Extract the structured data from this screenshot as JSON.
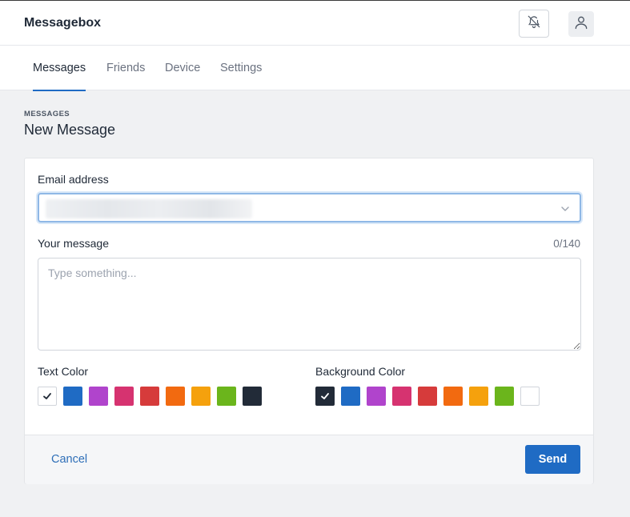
{
  "app": {
    "title": "Messagebox"
  },
  "header": {
    "bell_icon": "bell-off-icon",
    "user_icon": "user-icon"
  },
  "tabs": [
    {
      "label": "Messages",
      "active": true
    },
    {
      "label": "Friends",
      "active": false
    },
    {
      "label": "Device",
      "active": false
    },
    {
      "label": "Settings",
      "active": false
    }
  ],
  "page": {
    "eyebrow": "MESSAGES",
    "title": "New Message"
  },
  "form": {
    "email_label": "Email address",
    "email_value": "••••••• ••••••••••••.•••",
    "message_label": "Your message",
    "message_counter": "0/140",
    "message_placeholder": "Type something...",
    "text_color_label": "Text Color",
    "background_color_label": "Background Color",
    "text_colors": [
      "#ffffff",
      "#1f6bc4",
      "#b044cc",
      "#d63370",
      "#d63b3b",
      "#f26a10",
      "#f5a10d",
      "#6bb51c",
      "#222b38"
    ],
    "text_color_selected": "#ffffff",
    "background_colors": [
      "#222b38",
      "#1f6bc4",
      "#b044cc",
      "#d63370",
      "#d63b3b",
      "#f26a10",
      "#f5a10d",
      "#6bb51c",
      "#ffffff"
    ],
    "background_color_selected": "#222b38"
  },
  "footer": {
    "cancel_label": "Cancel",
    "send_label": "Send"
  },
  "colors": {
    "accent": "#1f6bc4",
    "page_bg": "#f0f1f3"
  }
}
